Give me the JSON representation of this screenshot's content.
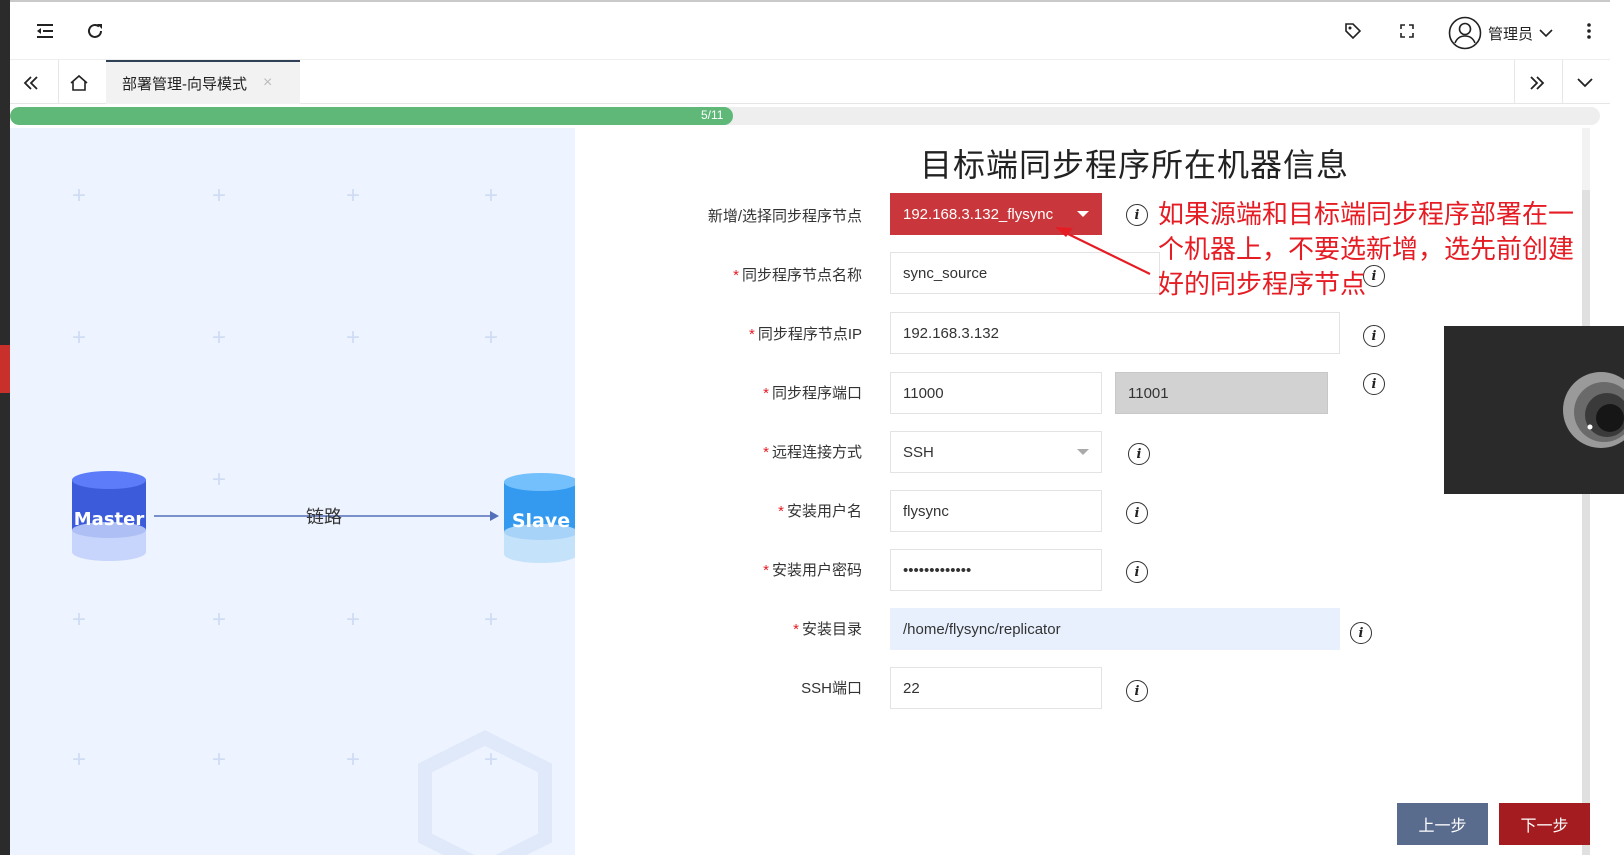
{
  "topbar": {
    "user_name": "管理员",
    "icons": [
      "menu-fold-icon",
      "refresh-icon",
      "tag-icon",
      "fullscreen-icon",
      "user-avatar-icon",
      "more-vertical-icon"
    ]
  },
  "tabs": {
    "active_label": "部署管理-向导模式",
    "close_glyph": "×"
  },
  "progress": {
    "text": "5/11",
    "fraction": 0.455,
    "color": "#5fb878"
  },
  "diagram": {
    "master_label": "Master",
    "slave_label": "Slave",
    "link_label": "链路"
  },
  "form": {
    "title": "目标端同步程序所在机器信息",
    "fields": [
      {
        "label": "新增/选择同步程序节点",
        "required": false,
        "value": "192.168.3.132_flysync"
      },
      {
        "label": "同步程序节点名称",
        "required": true,
        "value": "sync_source"
      },
      {
        "label": "同步程序节点IP",
        "required": true,
        "value": "192.168.3.132"
      },
      {
        "label": "同步程序端口",
        "required": true,
        "value": "11000",
        "value2": "11001"
      },
      {
        "label": "远程连接方式",
        "required": true,
        "value": "SSH"
      },
      {
        "label": "安装用户名",
        "required": true,
        "value": "flysync"
      },
      {
        "label": "安装用户密码",
        "required": true,
        "value": "•••••••••••••"
      },
      {
        "label": "安装目录",
        "required": true,
        "value": "/home/flysync/replicator"
      },
      {
        "label": "SSH端口",
        "required": false,
        "value": "22"
      }
    ],
    "required_mark": "*",
    "info_glyph": "i"
  },
  "annotation": {
    "text": "如果源端和目标端同步程序部署在一个机器上，不要选新增，选先前创建好的同步程序节点",
    "color": "#e51c23"
  },
  "buttons": {
    "prev": "上一步",
    "next": "下一步"
  },
  "colors": {
    "accent_red": "#c9373c",
    "prev_button": "#5a6c8d",
    "next_button": "#a51c20"
  }
}
